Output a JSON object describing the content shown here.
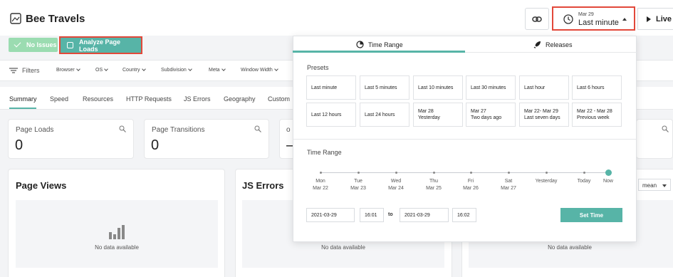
{
  "app": {
    "title": "Bee Travels"
  },
  "header": {
    "time_date": "Mar 29",
    "time_range": "Last minute",
    "live_label": "Live"
  },
  "status": {
    "no_issues": "No Issues",
    "analyze": "Analyze Page Loads"
  },
  "filters": {
    "label": "Filters",
    "items": [
      "Browser",
      "OS",
      "Country",
      "Subdivision",
      "Meta",
      "Window Width"
    ]
  },
  "tabs": [
    "Summary",
    "Speed",
    "Resources",
    "HTTP Requests",
    "JS Errors",
    "Geography",
    "Custom"
  ],
  "metrics": [
    {
      "label": "Page Loads",
      "value": "0"
    },
    {
      "label": "Page Transitions",
      "value": "0"
    },
    {
      "label": "o",
      "value": "–"
    }
  ],
  "panels": {
    "page_views": {
      "title": "Page Views",
      "empty": "No data available"
    },
    "js_errors": {
      "title": "JS Errors",
      "empty": "No data available"
    },
    "third": {
      "empty": "No data available",
      "select": "mean"
    }
  },
  "popover": {
    "tab_time_range": "Time Range",
    "tab_releases": "Releases",
    "presets_label": "Presets",
    "presets": [
      {
        "line1": "Last minute",
        "line2": ""
      },
      {
        "line1": "Last 5 minutes",
        "line2": ""
      },
      {
        "line1": "Last 10 minutes",
        "line2": ""
      },
      {
        "line1": "Last 30 minutes",
        "line2": ""
      },
      {
        "line1": "Last hour",
        "line2": ""
      },
      {
        "line1": "Last 6 hours",
        "line2": ""
      },
      {
        "line1": "Last 12 hours",
        "line2": ""
      },
      {
        "line1": "Last 24 hours",
        "line2": ""
      },
      {
        "line1": "Mar 28",
        "line2": "Yesterday"
      },
      {
        "line1": "Mar 27",
        "line2": "Two days ago"
      },
      {
        "line1": "Mar 22- Mar 29",
        "line2": "Last seven days"
      },
      {
        "line1": "Mar 22 - Mar 28",
        "line2": "Previous week"
      }
    ],
    "range_label": "Time Range",
    "timeline": [
      {
        "line1": "Mon",
        "line2": "Mar 22"
      },
      {
        "line1": "Tue",
        "line2": "Mar 23"
      },
      {
        "line1": "Wed",
        "line2": "Mar 24"
      },
      {
        "line1": "Thu",
        "line2": "Mar 25"
      },
      {
        "line1": "Fri",
        "line2": "Mar 26"
      },
      {
        "line1": "Sat",
        "line2": "Mar 27"
      },
      {
        "line1": "Yesterday",
        "line2": ""
      },
      {
        "line1": "Today",
        "line2": ""
      },
      {
        "line1": "Now",
        "line2": ""
      }
    ],
    "from_date": "2021-03-29",
    "from_time": "16:01",
    "to_label": "to",
    "to_date": "2021-03-29",
    "to_time": "16:02",
    "set_time": "Set Time"
  },
  "colors": {
    "accent": "#57b4a7",
    "highlight": "#e2483a",
    "success": "#9bdcb1"
  }
}
